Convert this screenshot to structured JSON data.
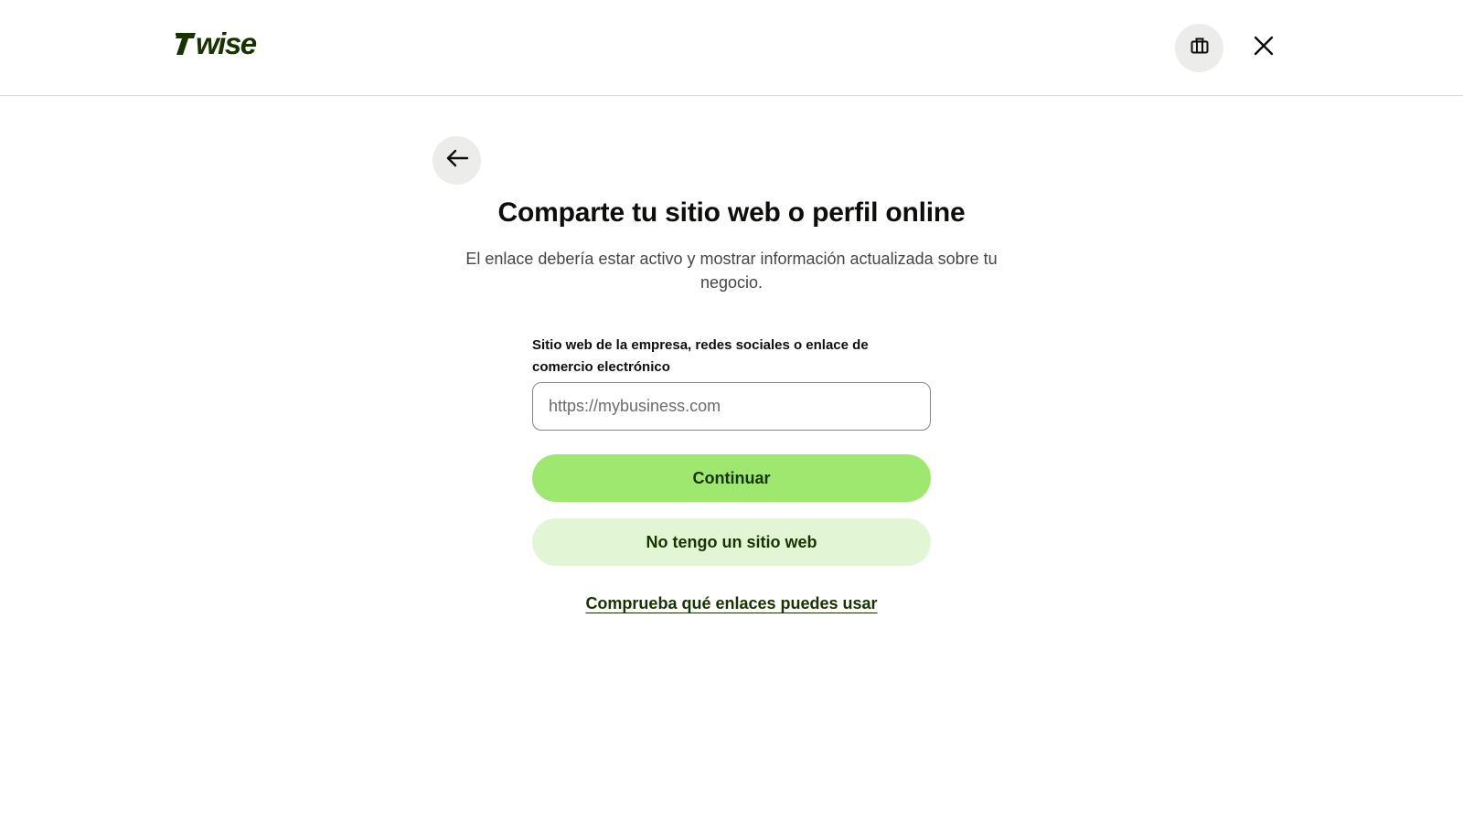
{
  "header": {
    "logo_text": "7WISE",
    "business_icon": "briefcase-icon",
    "close_icon": "close-icon"
  },
  "main": {
    "back_icon": "arrow-left-icon",
    "title": "Comparte tu sitio web o perfil online",
    "subtitle": "El enlace debería estar activo y mostrar información actualizada sobre tu negocio.",
    "field": {
      "label": "Sitio web de la empresa, redes sociales o enlace de comercio electrónico",
      "placeholder": "https://mybusiness.com",
      "value": ""
    },
    "continue_label": "Continuar",
    "no_website_label": "No tengo un sitio web",
    "help_link_label": "Comprueba qué enlaces puedes usar"
  },
  "colors": {
    "brand_green": "#9fe870",
    "light_green": "#e2f6d5",
    "forest_green": "#163300",
    "icon_bg": "#ececea"
  }
}
